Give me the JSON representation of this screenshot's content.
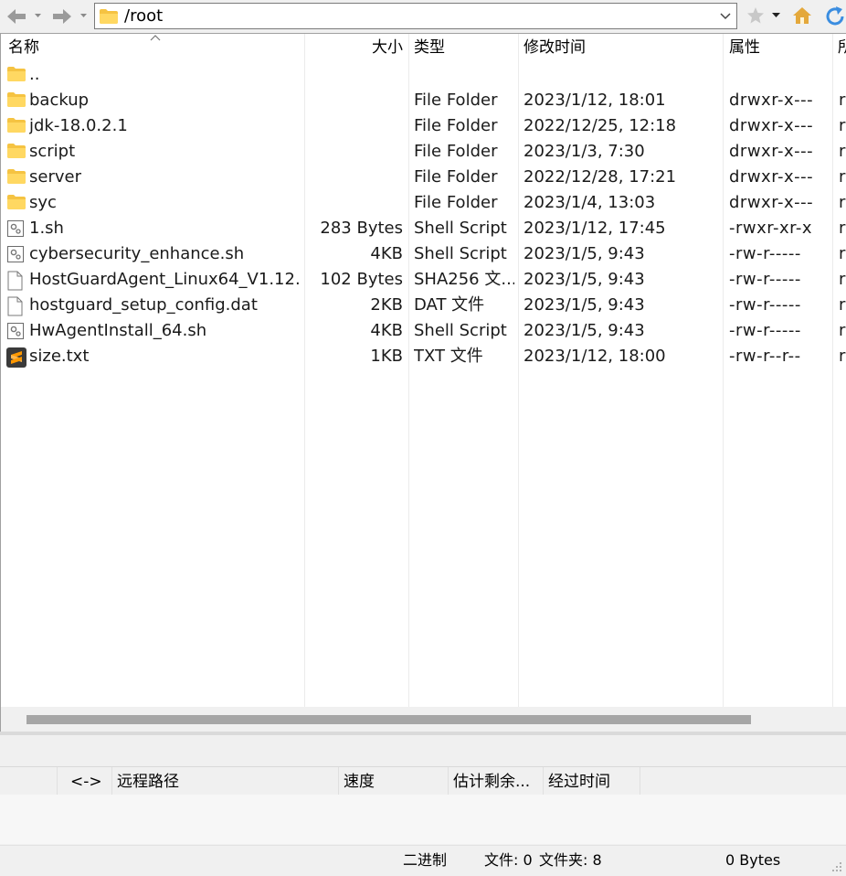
{
  "toolbar": {
    "path": "/root",
    "icons": [
      "back-arrow-icon",
      "forward-arrow-icon",
      "folder-icon",
      "chevron-down-icon",
      "bookmark-star-icon",
      "home-icon",
      "refresh-icon"
    ]
  },
  "columns": {
    "name": "名称",
    "size": "大小",
    "type": "类型",
    "modified": "修改时间",
    "attributes": "属性",
    "owner": "所"
  },
  "files": [
    {
      "name": "..",
      "size": "",
      "type": "",
      "modified": "",
      "attributes": "",
      "owner": "",
      "icon": "folder-icon"
    },
    {
      "name": "backup",
      "size": "",
      "type": "File Folder",
      "modified": "2023/1/12, 18:01",
      "attributes": "drwxr-x---",
      "owner": "r",
      "icon": "folder-icon"
    },
    {
      "name": "jdk-18.0.2.1",
      "size": "",
      "type": "File Folder",
      "modified": "2022/12/25, 12:18",
      "attributes": "drwxr-x---",
      "owner": "r",
      "icon": "folder-icon"
    },
    {
      "name": "script",
      "size": "",
      "type": "File Folder",
      "modified": "2023/1/3, 7:30",
      "attributes": "drwxr-x---",
      "owner": "r",
      "icon": "folder-icon"
    },
    {
      "name": "server",
      "size": "",
      "type": "File Folder",
      "modified": "2022/12/28, 17:21",
      "attributes": "drwxr-x---",
      "owner": "r",
      "icon": "folder-icon"
    },
    {
      "name": "syc",
      "size": "",
      "type": "File Folder",
      "modified": "2023/1/4, 13:03",
      "attributes": "drwxr-x---",
      "owner": "r",
      "icon": "folder-icon"
    },
    {
      "name": "1.sh",
      "size": "283 Bytes",
      "type": "Shell Script",
      "modified": "2023/1/12, 17:45",
      "attributes": "-rwxr-xr-x",
      "owner": "r",
      "icon": "shell-script-icon"
    },
    {
      "name": "cybersecurity_enhance.sh",
      "size": "4KB",
      "type": "Shell Script",
      "modified": "2023/1/5, 9:43",
      "attributes": "-rw-r-----",
      "owner": "r",
      "icon": "shell-script-icon"
    },
    {
      "name": "HostGuardAgent_Linux64_V1.12....",
      "size": "102 Bytes",
      "type": "SHA256 文...",
      "modified": "2023/1/5, 9:43",
      "attributes": "-rw-r-----",
      "owner": "r",
      "icon": "blank-file-icon"
    },
    {
      "name": "hostguard_setup_config.dat",
      "size": "2KB",
      "type": "DAT 文件",
      "modified": "2023/1/5, 9:43",
      "attributes": "-rw-r-----",
      "owner": "r",
      "icon": "blank-file-icon"
    },
    {
      "name": "HwAgentInstall_64.sh",
      "size": "4KB",
      "type": "Shell Script",
      "modified": "2023/1/5, 9:43",
      "attributes": "-rw-r-----",
      "owner": "r",
      "icon": "shell-script-icon"
    },
    {
      "name": "size.txt",
      "size": "1KB",
      "type": "TXT 文件",
      "modified": "2023/1/12, 18:00",
      "attributes": "-rw-r--r--",
      "owner": "r",
      "icon": "sublime-text-icon"
    }
  ],
  "queue": {
    "direction": "<->",
    "remote_path": "远程路径",
    "speed": "速度",
    "eta": "估计剩余...",
    "elapsed": "经过时间"
  },
  "status": {
    "mode": "二进制",
    "files": "文件: 0",
    "folders": "文件夹: 8",
    "size": "0 Bytes"
  }
}
